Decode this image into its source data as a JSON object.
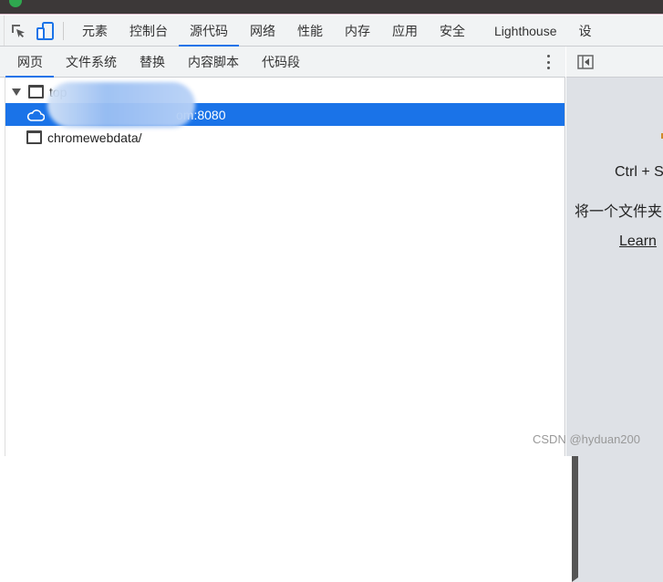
{
  "devtools_tabs": [
    {
      "label": "元素"
    },
    {
      "label": "控制台"
    },
    {
      "label": "源代码",
      "active": true
    },
    {
      "label": "网络"
    },
    {
      "label": "性能"
    },
    {
      "label": "内存"
    },
    {
      "label": "应用"
    },
    {
      "label": "安全"
    },
    {
      "label": "Lighthouse"
    },
    {
      "label": "设"
    }
  ],
  "sources_tabs": [
    {
      "label": "网页",
      "active": true
    },
    {
      "label": "文件系统"
    },
    {
      "label": "替换"
    },
    {
      "label": "内容脚本"
    },
    {
      "label": "代码段"
    }
  ],
  "tree": {
    "top": "top",
    "origin": "om:8080",
    "chromewebdata": "chromewebdata/"
  },
  "right_panel": {
    "shortcut": "Ctrl + S",
    "hint": "将一个文件夹",
    "learn": "Learn"
  },
  "watermark": "CSDN @hyduan200",
  "colors": {
    "accent": "#1a73e8",
    "selected_row": "#1a73e8"
  }
}
